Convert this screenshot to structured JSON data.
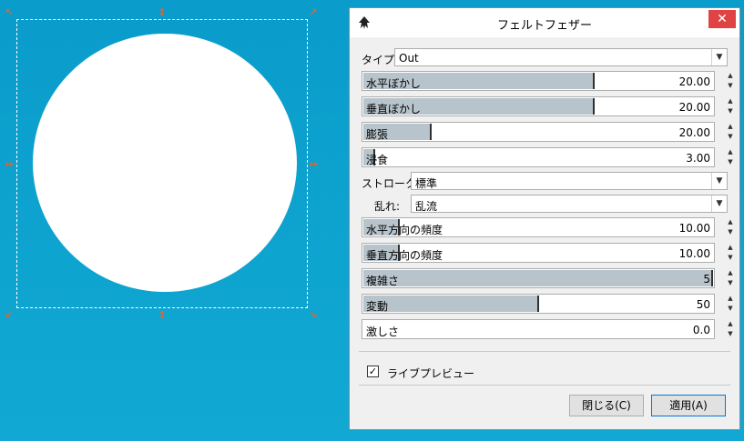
{
  "dialog": {
    "title": "フェルトフェザー",
    "close_label": "✕",
    "type_label": "タイプ:",
    "type_value": "Out",
    "stroke_label": "ストローク:",
    "stroke_value": "標準",
    "turbulence_label": "乱れ:",
    "turbulence_value": "乱流",
    "sliders": [
      {
        "name": "水平ぼかし",
        "value": "20.00",
        "level": 0.66
      },
      {
        "name": "垂直ぼかし",
        "value": "20.00",
        "level": 0.66
      },
      {
        "name": "膨張",
        "value": "20.00",
        "level": 0.19
      },
      {
        "name": "浸食",
        "value": "3.00",
        "level": 0.03
      },
      {
        "name": "水平方向の頻度",
        "value": "10.00",
        "level": 0.1
      },
      {
        "name": "垂直方向の頻度",
        "value": "10.00",
        "level": 0.1
      },
      {
        "name": "複雑さ",
        "value": "5",
        "level": 1.0
      },
      {
        "name": "変動",
        "value": "50",
        "level": 0.5
      },
      {
        "name": "激しさ",
        "value": "0.0",
        "level": 0.0
      }
    ],
    "live_preview_label": "ライブプレビュー",
    "live_preview_checked": true,
    "close_button": "閉じる(C)",
    "apply_button": "適用(A)"
  },
  "colors": {
    "canvas_bg": "#0ea3cc",
    "handle": "#e8622c",
    "slider_fill": "#b8c4cc",
    "close_button_bg": "#e04343"
  }
}
